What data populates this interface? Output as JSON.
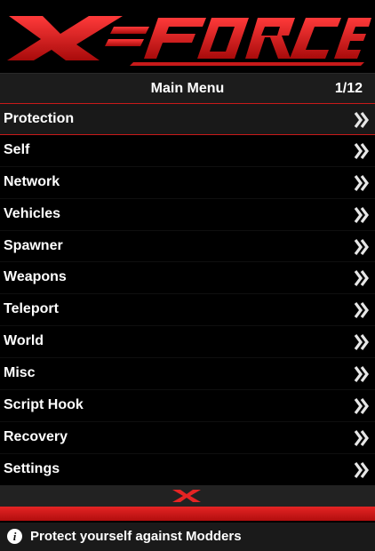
{
  "banner": {
    "logo_text": "X=FORCE",
    "accent_color": "#e52424"
  },
  "header": {
    "title": "Main Menu",
    "count": "1/12"
  },
  "menu": {
    "items": [
      {
        "label": "Protection",
        "icon": "double-chevron-right-icon"
      },
      {
        "label": "Self",
        "icon": "double-chevron-right-icon"
      },
      {
        "label": "Network",
        "icon": "double-chevron-right-icon"
      },
      {
        "label": "Vehicles",
        "icon": "double-chevron-right-icon"
      },
      {
        "label": "Spawner",
        "icon": "double-chevron-right-icon"
      },
      {
        "label": "Weapons",
        "icon": "double-chevron-right-icon"
      },
      {
        "label": "Teleport",
        "icon": "double-chevron-right-icon"
      },
      {
        "label": "World",
        "icon": "double-chevron-right-icon"
      },
      {
        "label": "Misc",
        "icon": "double-chevron-right-icon"
      },
      {
        "label": "Script Hook",
        "icon": "double-chevron-right-icon"
      },
      {
        "label": "Recovery",
        "icon": "double-chevron-right-icon"
      },
      {
        "label": "Settings",
        "icon": "double-chevron-right-icon"
      }
    ],
    "selected": "Protection"
  },
  "footer": {
    "icon": "x-logo-icon"
  },
  "info": {
    "icon": "info-icon",
    "icon_glyph": "i",
    "message": "Protect yourself against Modders"
  }
}
